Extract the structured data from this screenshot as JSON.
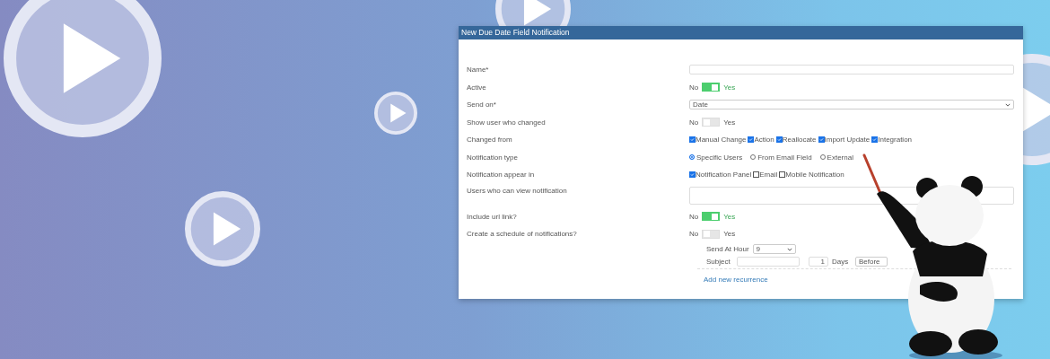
{
  "window": {
    "title": "New Due Date Field Notification"
  },
  "fields": [
    {
      "kind": "text",
      "label": "Name*"
    },
    {
      "kind": "toggle",
      "label": "Active",
      "off_label": "No",
      "on_label": "Yes",
      "on": true
    },
    {
      "kind": "select",
      "label": "Send on*",
      "value": "Date"
    },
    {
      "kind": "toggle",
      "label": "Show user who changed",
      "off_label": "No",
      "on_label": "Yes",
      "on": false
    },
    {
      "kind": "checkboxes",
      "label": "Changed from",
      "options": [
        {
          "label": "Manual Change",
          "checked": true
        },
        {
          "label": "Action",
          "checked": true
        },
        {
          "label": "Reallocate",
          "checked": true
        },
        {
          "label": "Import Update",
          "checked": true
        },
        {
          "label": "Integration",
          "checked": true
        }
      ]
    },
    {
      "kind": "radios",
      "label": "Notification type",
      "options": [
        {
          "label": "Specific Users",
          "selected": true
        },
        {
          "label": "From Email Field",
          "selected": false
        },
        {
          "label": "External",
          "selected": false
        }
      ]
    },
    {
      "kind": "checkboxes",
      "label": "Notification appear in",
      "options": [
        {
          "label": "Notification Panel",
          "checked": true
        },
        {
          "label": "Email",
          "checked": false
        },
        {
          "label": "Mobile Notification",
          "checked": false
        }
      ]
    },
    {
      "kind": "textarea",
      "label": "Users who can view notification"
    },
    {
      "kind": "toggle",
      "label": "Include url link?",
      "off_label": "No",
      "on_label": "Yes",
      "on": true
    },
    {
      "kind": "toggle",
      "label": "Create a schedule of notifications?",
      "off_label": "No",
      "on_label": "Yes",
      "on": false
    }
  ],
  "schedule": {
    "hour_label": "Send At Hour",
    "hour": "9",
    "subject_label": "Subject",
    "count": "1",
    "unit": "Days",
    "relation": "Before",
    "add_link": "Add new recurrence"
  }
}
